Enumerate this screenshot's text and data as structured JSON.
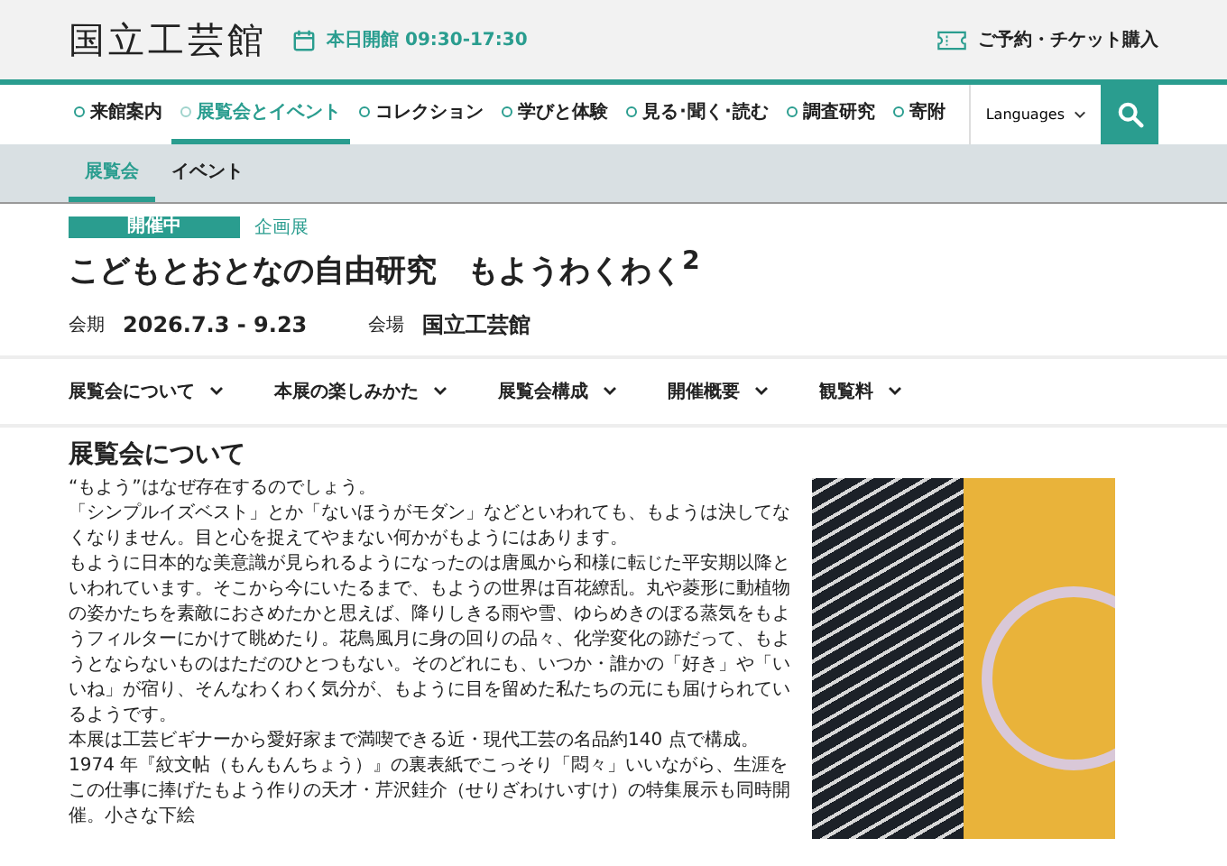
{
  "header": {
    "logo": "国立工芸館",
    "hours": "本日開館 09:30-17:30",
    "ticket_link": "ご予約・チケット購入"
  },
  "nav": {
    "items": [
      {
        "label": "来館案内",
        "selected": false
      },
      {
        "label": "展覧会とイベント",
        "selected": true
      },
      {
        "label": "コレクション",
        "selected": false
      },
      {
        "label": "学びと体験",
        "selected": false
      },
      {
        "label": "見る･聞く･読む",
        "selected": false
      },
      {
        "label": "調査研究",
        "selected": false
      },
      {
        "label": "寄附",
        "selected": false
      }
    ],
    "languages": "Languages"
  },
  "subnav": [
    {
      "label": "展覧会",
      "selected": true
    },
    {
      "label": "イベント",
      "selected": false
    }
  ],
  "exhibition": {
    "status": "開催中",
    "category": "企画展",
    "title": "こどもとおとなの自由研究　もようわくわく$^{2}$",
    "meta": [
      {
        "label": "会期",
        "value": "2026.7.3 - 9.23"
      },
      {
        "label": "会場",
        "value": "国立工芸館"
      }
    ]
  },
  "anchor_tabs": [
    "展覧会について",
    "本展の楽しみかた",
    "展覧会構成",
    "開催概要",
    "観覧料"
  ],
  "about": {
    "heading": "展覧会について",
    "paragraphs": [
      "“もよう”はなぜ存在するのでしょう。",
      "「シンプルイズベスト」とか「ないほうがモダン」などといわれても、もようは決してなくなりません。目と心を捉えてやまない何かがもようにはあります。",
      "もように日本的な美意識が見られるようになったのは唐風から和様に転じた平安期以降といわれています。そこから今にいたるまで、もようの世界は百花繚乱。丸や菱形に動植物の姿かたちを素敵におさめたかと思えば、降りしきる雨や雪、ゆらめきのぼる蒸気をもようフィルターにかけて眺めたり。花鳥風月に身の回りの品々、化学変化の跡だって、もようとならないものはただのひとつもない。そのどれにも、いつか・誰かの「好き」や「いいね」が宿り、そんなわくわく気分が、もように目を留めた私たちの元にも届けられているようです。",
      "本展は工芸ビギナーから愛好家まで満喫できる近・現代工芸の名品約140 点で構成。",
      "1974 年『紋文帖（もんもんちょう）』の裏表紙でこっそり「悶々」いいながら、生涯をこの仕事に捧げたもよう作りの天才・芹沢銈介（せりざわけいすけ）の特集展示も同時開催。小さな下絵"
    ]
  }
}
